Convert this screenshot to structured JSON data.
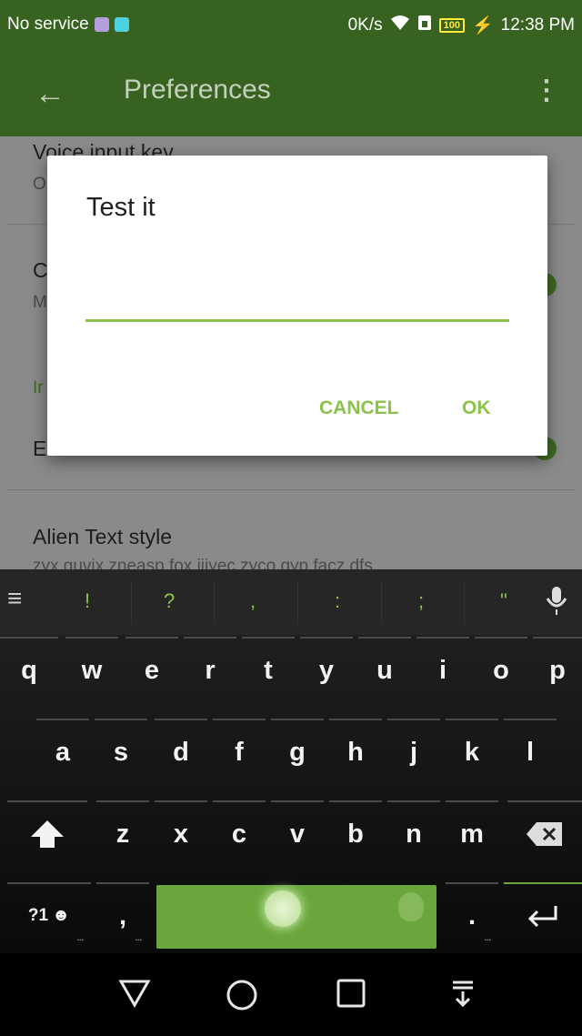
{
  "status": {
    "carrier": "No service",
    "speed": "0K/s",
    "battery": "100",
    "time": "12:38 PM",
    "icons": [
      "wifi-icon",
      "sim-icon",
      "battery-icon",
      "charging-icon"
    ]
  },
  "appbar": {
    "title": "Preferences",
    "back_icon": "arrow-left-icon",
    "menu_icon": "more-vert-icon"
  },
  "settings": {
    "voice_title": "Voice input key",
    "voice_summary": "O",
    "item2_title": "C",
    "item2_summary": "M",
    "category_label": "Ir",
    "item3_title": "E",
    "alien_title": "Alien Text style",
    "alien_summary": "zyx guvix zneasp fox jiiyec zyco qyp facz dfs"
  },
  "dialog": {
    "title": "Test it",
    "input_value": "",
    "cancel": "CANCEL",
    "ok": "OK"
  },
  "keyboard": {
    "suggestions": [
      "!",
      "?",
      ",",
      ":",
      ";",
      "\""
    ],
    "row1": [
      "q",
      "w",
      "e",
      "r",
      "t",
      "y",
      "u",
      "i",
      "o",
      "p"
    ],
    "row2": [
      "a",
      "s",
      "d",
      "f",
      "g",
      "h",
      "j",
      "k",
      "l"
    ],
    "row3": [
      "z",
      "x",
      "c",
      "v",
      "b",
      "n",
      "m"
    ],
    "symbols_key": "?1",
    "comma": ",",
    "period": ".",
    "accent_color": "#8bc34a"
  },
  "colors": {
    "primary": "#37621f",
    "accent": "#8bc34a"
  }
}
